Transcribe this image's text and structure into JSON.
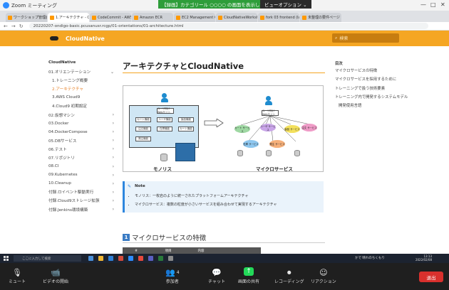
{
  "zoom": {
    "window_title": "Zoom ミーティング",
    "share_banner": "【録画】カテゴリール ○○○○ の画面を表示しています",
    "share_option": "ビューオプション ⌄"
  },
  "browser": {
    "tabs": [
      {
        "label": "ワークショップ管理画 - codep"
      },
      {
        "label": "1.アーキテクチャ - CloudNa",
        "active": true
      },
      {
        "label": "CodeCommit - AWS Devel"
      },
      {
        "label": "Amazon ECR"
      },
      {
        "label": "EC2 Management Console"
      },
      {
        "label": "CloudNativeWorkshop"
      },
      {
        "label": "fork 03 frontend (latest)"
      },
      {
        "label": "未整理の要件ページ"
      }
    ],
    "url": "20220207-ondigo-basic.pcusanusr.rcgp/01-orientations/01-architecture.html"
  },
  "site": {
    "brand": "CloudNative",
    "search_placeholder": "検索"
  },
  "sidebar": {
    "title": "CloudNative",
    "items": [
      {
        "label": "01.オリエンテーション",
        "expanded": true
      },
      {
        "label": "1.トレーニング概要",
        "sub": true
      },
      {
        "label": "2.アーキテクチャ",
        "sub": true,
        "current": true
      },
      {
        "label": "3.AWS Cloud9",
        "sub": true
      },
      {
        "label": "4.Cloud9 初期設定",
        "sub": true
      },
      {
        "label": "02.仮想マシン"
      },
      {
        "label": "03.Docker"
      },
      {
        "label": "04.DockerCompose"
      },
      {
        "label": "05.DBサービス"
      },
      {
        "label": "06.テスト"
      },
      {
        "label": "07.リポジトリ"
      },
      {
        "label": "08.CI"
      },
      {
        "label": "09.Kubernetes"
      },
      {
        "label": "10.Cleanup"
      },
      {
        "label": "付録.ロイベント駆動実行"
      },
      {
        "label": "付録.Cloud9ストレージ拡張"
      },
      {
        "label": "付録.Jenkins環境構築"
      }
    ]
  },
  "article": {
    "title": "アーキテクチャとCloudNative",
    "figure": {
      "monolith_caption": "モノリス",
      "microservice_caption": "マイクロサービス",
      "mono_ui": "ユーザ向け Webサイト",
      "mono_boxes": [
        "カート機能",
        "ユーザ機能",
        "製品機能",
        "注文機能",
        "在庫機能",
        "カート機能",
        "発注機能"
      ],
      "micro_ui": "ユーザ向け Webサイト",
      "micro_services": [
        "カート サービス",
        "ユーザ サービス",
        "製品 サービス",
        "注文 サービス",
        "在庫 サービス",
        "発注 サービス"
      ]
    },
    "note": {
      "heading": "Note",
      "items": [
        "モノリス：一枚岩のように統一されたプラットフォームアーキテクチャ",
        "マイクロサービス：複数の粒度が小さいサービスを組み合わせて実現するアーキテクチャ"
      ]
    },
    "section_number": "1",
    "section_title": "マイクロサービスの特徴",
    "table_headers": [
      "#",
      "項目",
      "内容"
    ]
  },
  "toc": {
    "title": "目次",
    "items": [
      {
        "label": "マイクロサービスの特徴"
      },
      {
        "label": "マイクロサービスを採用するために"
      },
      {
        "label": "トレーニングで扱う技術要素"
      },
      {
        "label": "トレーニング内で開発するシステムモデル"
      },
      {
        "label": "開発使用言語",
        "sub": true
      }
    ]
  },
  "taskbar": {
    "search_placeholder": "ここに入力して検索",
    "weather": "かで 晴れのちくもり",
    "time": "13:13",
    "date": "2022/02/08"
  },
  "meeting_controls": {
    "mute": "ミュート",
    "video": "ビデオの開始",
    "participants": "参加者",
    "participants_count": "4",
    "chat": "チャット",
    "share": "画面の共有",
    "record": "レコーディング",
    "reactions": "リアクション",
    "leave": "退出"
  }
}
